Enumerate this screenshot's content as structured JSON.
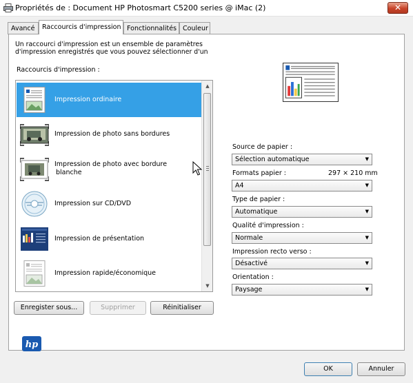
{
  "window": {
    "title": "Propriétés de : Document HP Photosmart C5200 series @ iMac (2)",
    "close_glyph": "✕"
  },
  "tabs": [
    {
      "label": "Avancé",
      "active": false
    },
    {
      "label": "Raccourcis d'impression",
      "active": true
    },
    {
      "label": "Fonctionnalités",
      "active": false
    },
    {
      "label": "Couleur",
      "active": false
    }
  ],
  "description": {
    "line1": "Un raccourci d'impression est un ensemble de paramètres",
    "line2": "d'impression enregistrés que vous pouvez sélectionner d'un"
  },
  "shortcuts": {
    "label": "Raccourcis d'impression :",
    "items": [
      {
        "line1": "Impression ordinaire",
        "line2": "",
        "icon": "document-icon",
        "selected": true
      },
      {
        "line1": "Impression de photo sans bordures",
        "line2": "",
        "icon": "borderless-photo-icon",
        "selected": false
      },
      {
        "line1": "Impression de photo avec bordure",
        "line2": "blanche",
        "icon": "bordered-photo-icon",
        "selected": false
      },
      {
        "line1": "Impression sur CD/DVD",
        "line2": "",
        "icon": "cd-dvd-icon",
        "selected": false
      },
      {
        "line1": "Impression de présentation",
        "line2": "",
        "icon": "presentation-icon",
        "selected": false
      },
      {
        "line1": "Impression rapide/économique",
        "line2": "",
        "icon": "document-icon",
        "selected": false
      }
    ],
    "scroll_up": "▲",
    "scroll_down": "▼"
  },
  "buttons": {
    "save_as": "Enregister sous...",
    "delete": "Supprimer",
    "reset": "Réinitialiser",
    "ok": "OK",
    "cancel": "Annuler"
  },
  "settings": {
    "paper_source": {
      "label": "Source de papier :",
      "value": "Sélection automatique"
    },
    "paper_size": {
      "label": "Formats papier :",
      "value": "A4",
      "dimensions": "297 × 210 mm"
    },
    "paper_type": {
      "label": "Type de papier :",
      "value": "Automatique"
    },
    "print_quality": {
      "label": "Qualité d'impression :",
      "value": "Normale"
    },
    "duplex": {
      "label": "Impression recto verso :",
      "value": "Désactivé"
    },
    "orientation": {
      "label": "Orientation :",
      "value": "Paysage"
    },
    "dropdown_arrow": "▼"
  },
  "colors": {
    "selection": "#35a0e6",
    "close_button": "#c8442a",
    "hp_blue": "#1a5ab0"
  },
  "brand": {
    "logo_text": "hp"
  }
}
